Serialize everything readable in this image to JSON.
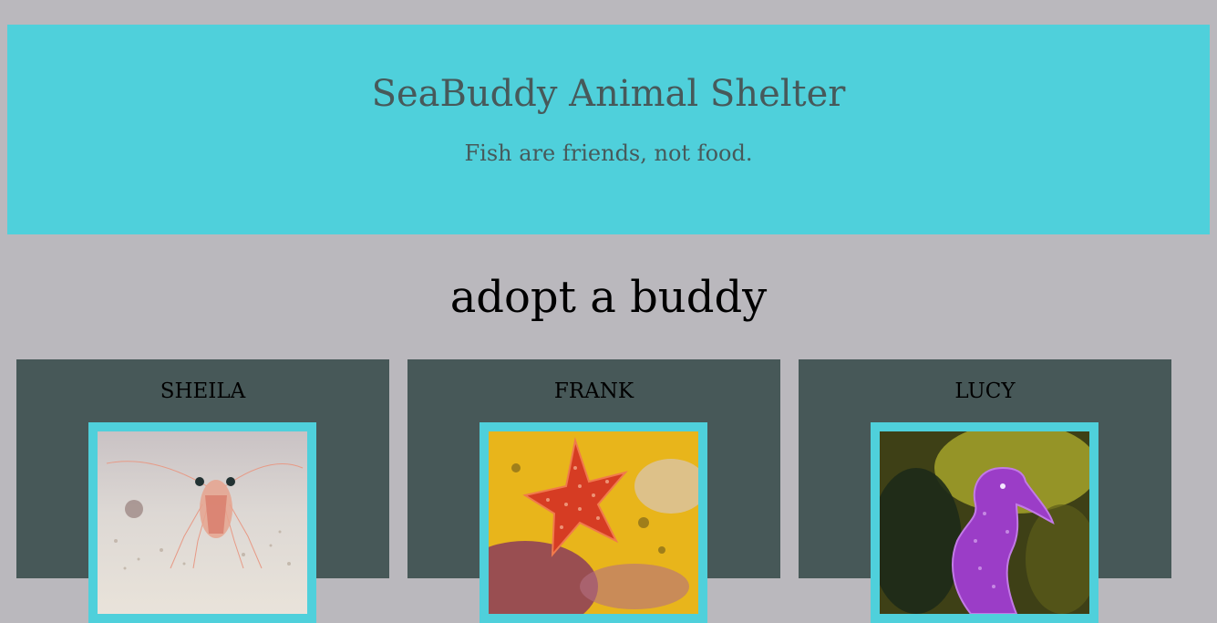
{
  "header": {
    "title": "SeaBuddy Animal Shelter",
    "tagline": "Fish are friends, not food."
  },
  "section": {
    "title": "adopt a buddy"
  },
  "buddies": [
    {
      "name": "SHEILA"
    },
    {
      "name": "FRANK"
    },
    {
      "name": "LUCY"
    }
  ],
  "colors": {
    "page_background": "#bab8bd",
    "header_background": "#4fd0db",
    "header_text": "#47595a",
    "card_background": "#475858",
    "photo_border": "#4fd0db"
  }
}
